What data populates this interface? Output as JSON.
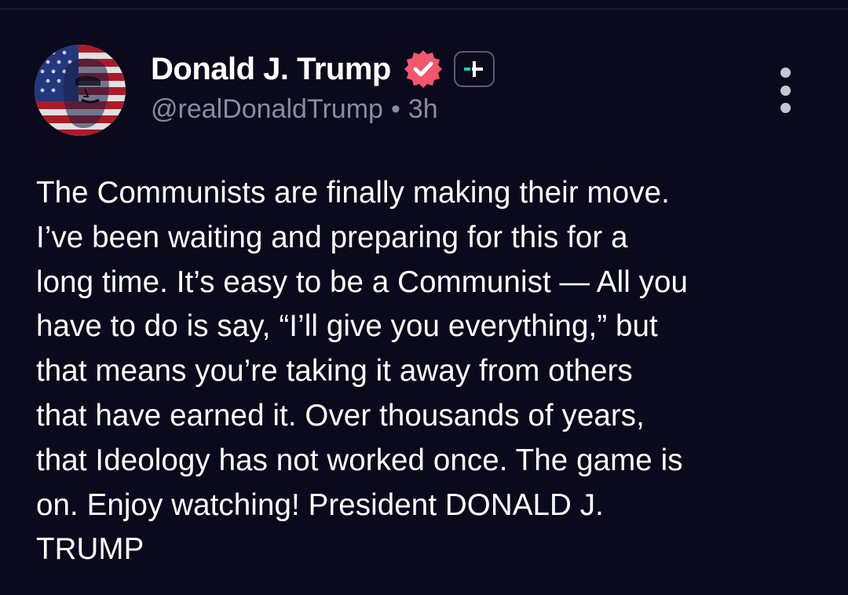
{
  "post": {
    "author": {
      "display_name": "Donald J. Trump",
      "handle": "@realDonaldTrump",
      "avatar_icon": "avatar-flag-portrait",
      "verified_icon": "verified-badge-icon",
      "plus_icon": "plus-badge-icon"
    },
    "separator": "•",
    "timestamp": "3h",
    "more_icon": "more-vertical-icon",
    "text_lines": [
      "The Communists are finally making their move.",
      "I’ve been waiting and preparing for this for a",
      "long time. It’s easy to be a Communist — All you",
      "have to do is say, “I’ll give you everything,” but",
      "that means you’re taking it away from others",
      "that have earned it. Over thousands of years,",
      "that Ideology has not worked once. The game is",
      "on. Enjoy watching! President DONALD J.",
      "TRUMP"
    ]
  },
  "colors": {
    "background": "#0b0a1c",
    "text_primary": "#ffffff",
    "text_secondary": "#8c8aa0",
    "verified": "#f2566d",
    "plus_accent": "#22c9b0"
  }
}
